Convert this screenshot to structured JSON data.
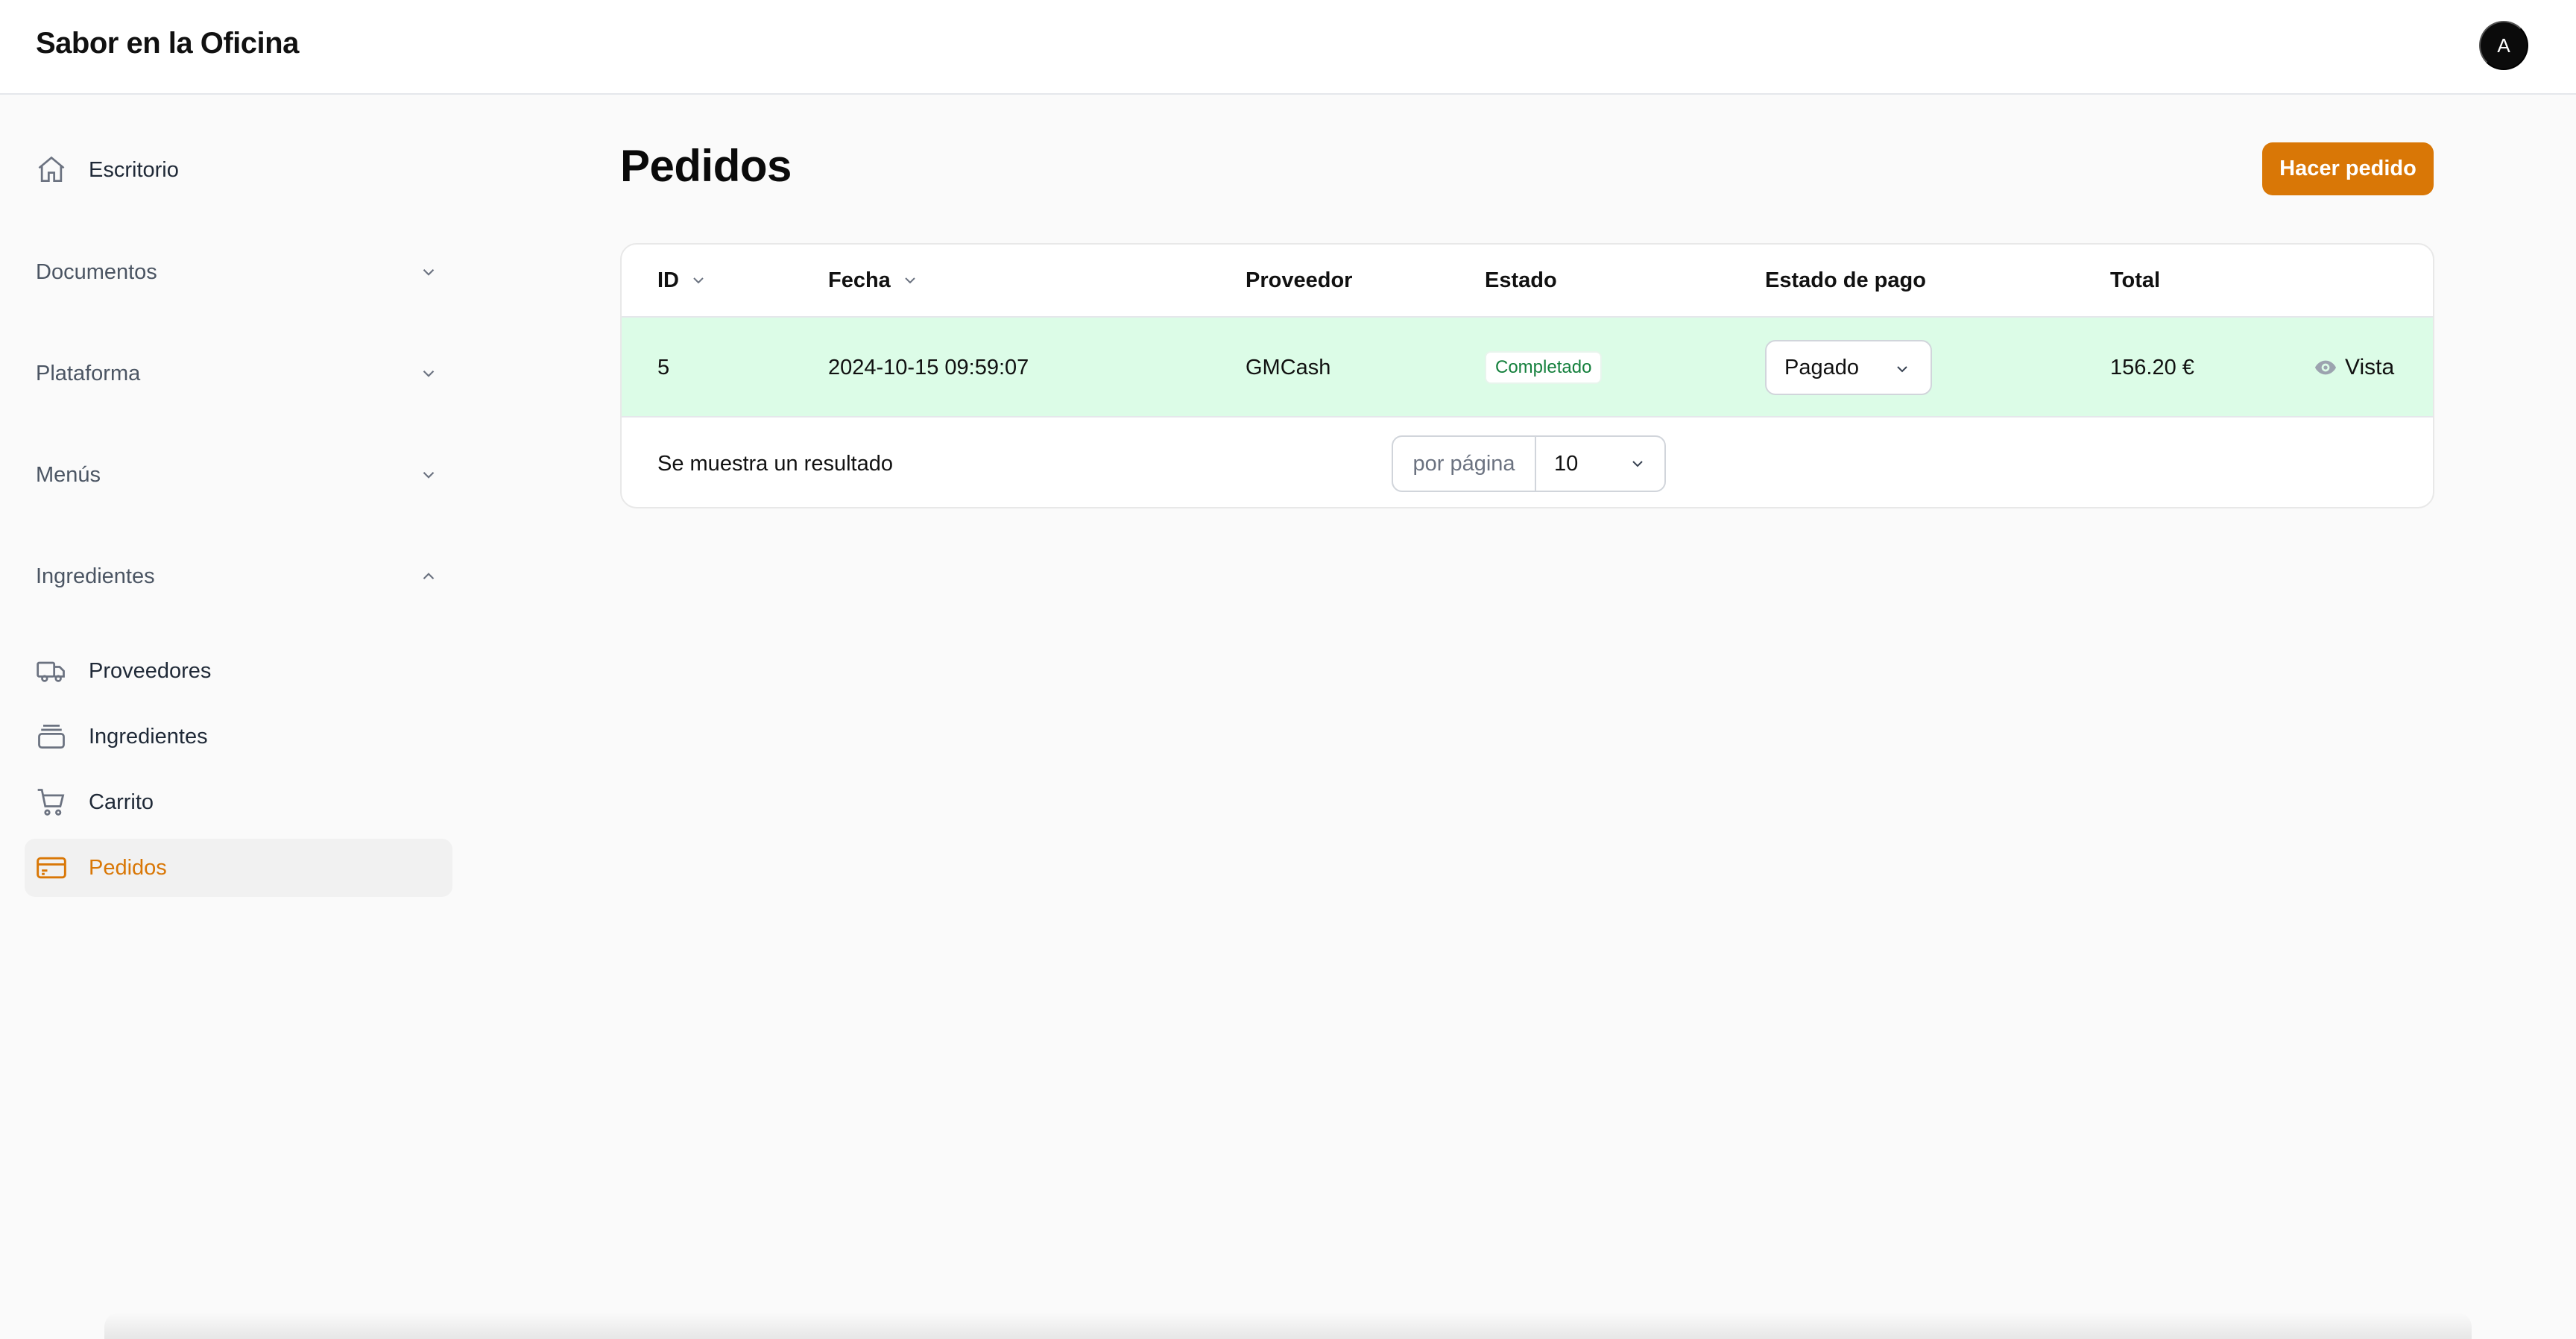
{
  "header": {
    "brand": "Sabor en la Oficina",
    "avatar_initial": "A"
  },
  "sidebar": {
    "dashboard": {
      "label": "Escritorio",
      "icon": "home-icon"
    },
    "groups": [
      {
        "label": "Documentos",
        "state": "collapsed"
      },
      {
        "label": "Plataforma",
        "state": "collapsed"
      },
      {
        "label": "Menús",
        "state": "collapsed"
      },
      {
        "label": "Ingredientes",
        "state": "expanded"
      }
    ],
    "items": [
      {
        "label": "Proveedores",
        "icon": "truck-icon"
      },
      {
        "label": "Ingredientes",
        "icon": "archive-icon"
      },
      {
        "label": "Carrito",
        "icon": "shopping-cart-icon"
      },
      {
        "label": "Pedidos",
        "icon": "credit-card-icon",
        "active": true
      }
    ]
  },
  "main": {
    "title": "Pedidos",
    "primary_action": "Hacer pedido",
    "table": {
      "columns": [
        "ID",
        "Fecha",
        "Proveedor",
        "Estado",
        "Estado de pago",
        "Total"
      ],
      "rows": [
        {
          "id": "5",
          "fecha": "2024-10-15 09:59:07",
          "proveedor": "GMCash",
          "estado": "Completado",
          "estado_pago": "Pagado",
          "total": "156.20 €",
          "action": "Vista"
        }
      ],
      "footer": {
        "result_text": "Se muestra un resultado",
        "per_page_label": "por página",
        "per_page_value": "10"
      }
    }
  },
  "colors": {
    "accent": "#d97706",
    "row_highlight": "#dcfce7",
    "badge_text": "#15803d"
  }
}
